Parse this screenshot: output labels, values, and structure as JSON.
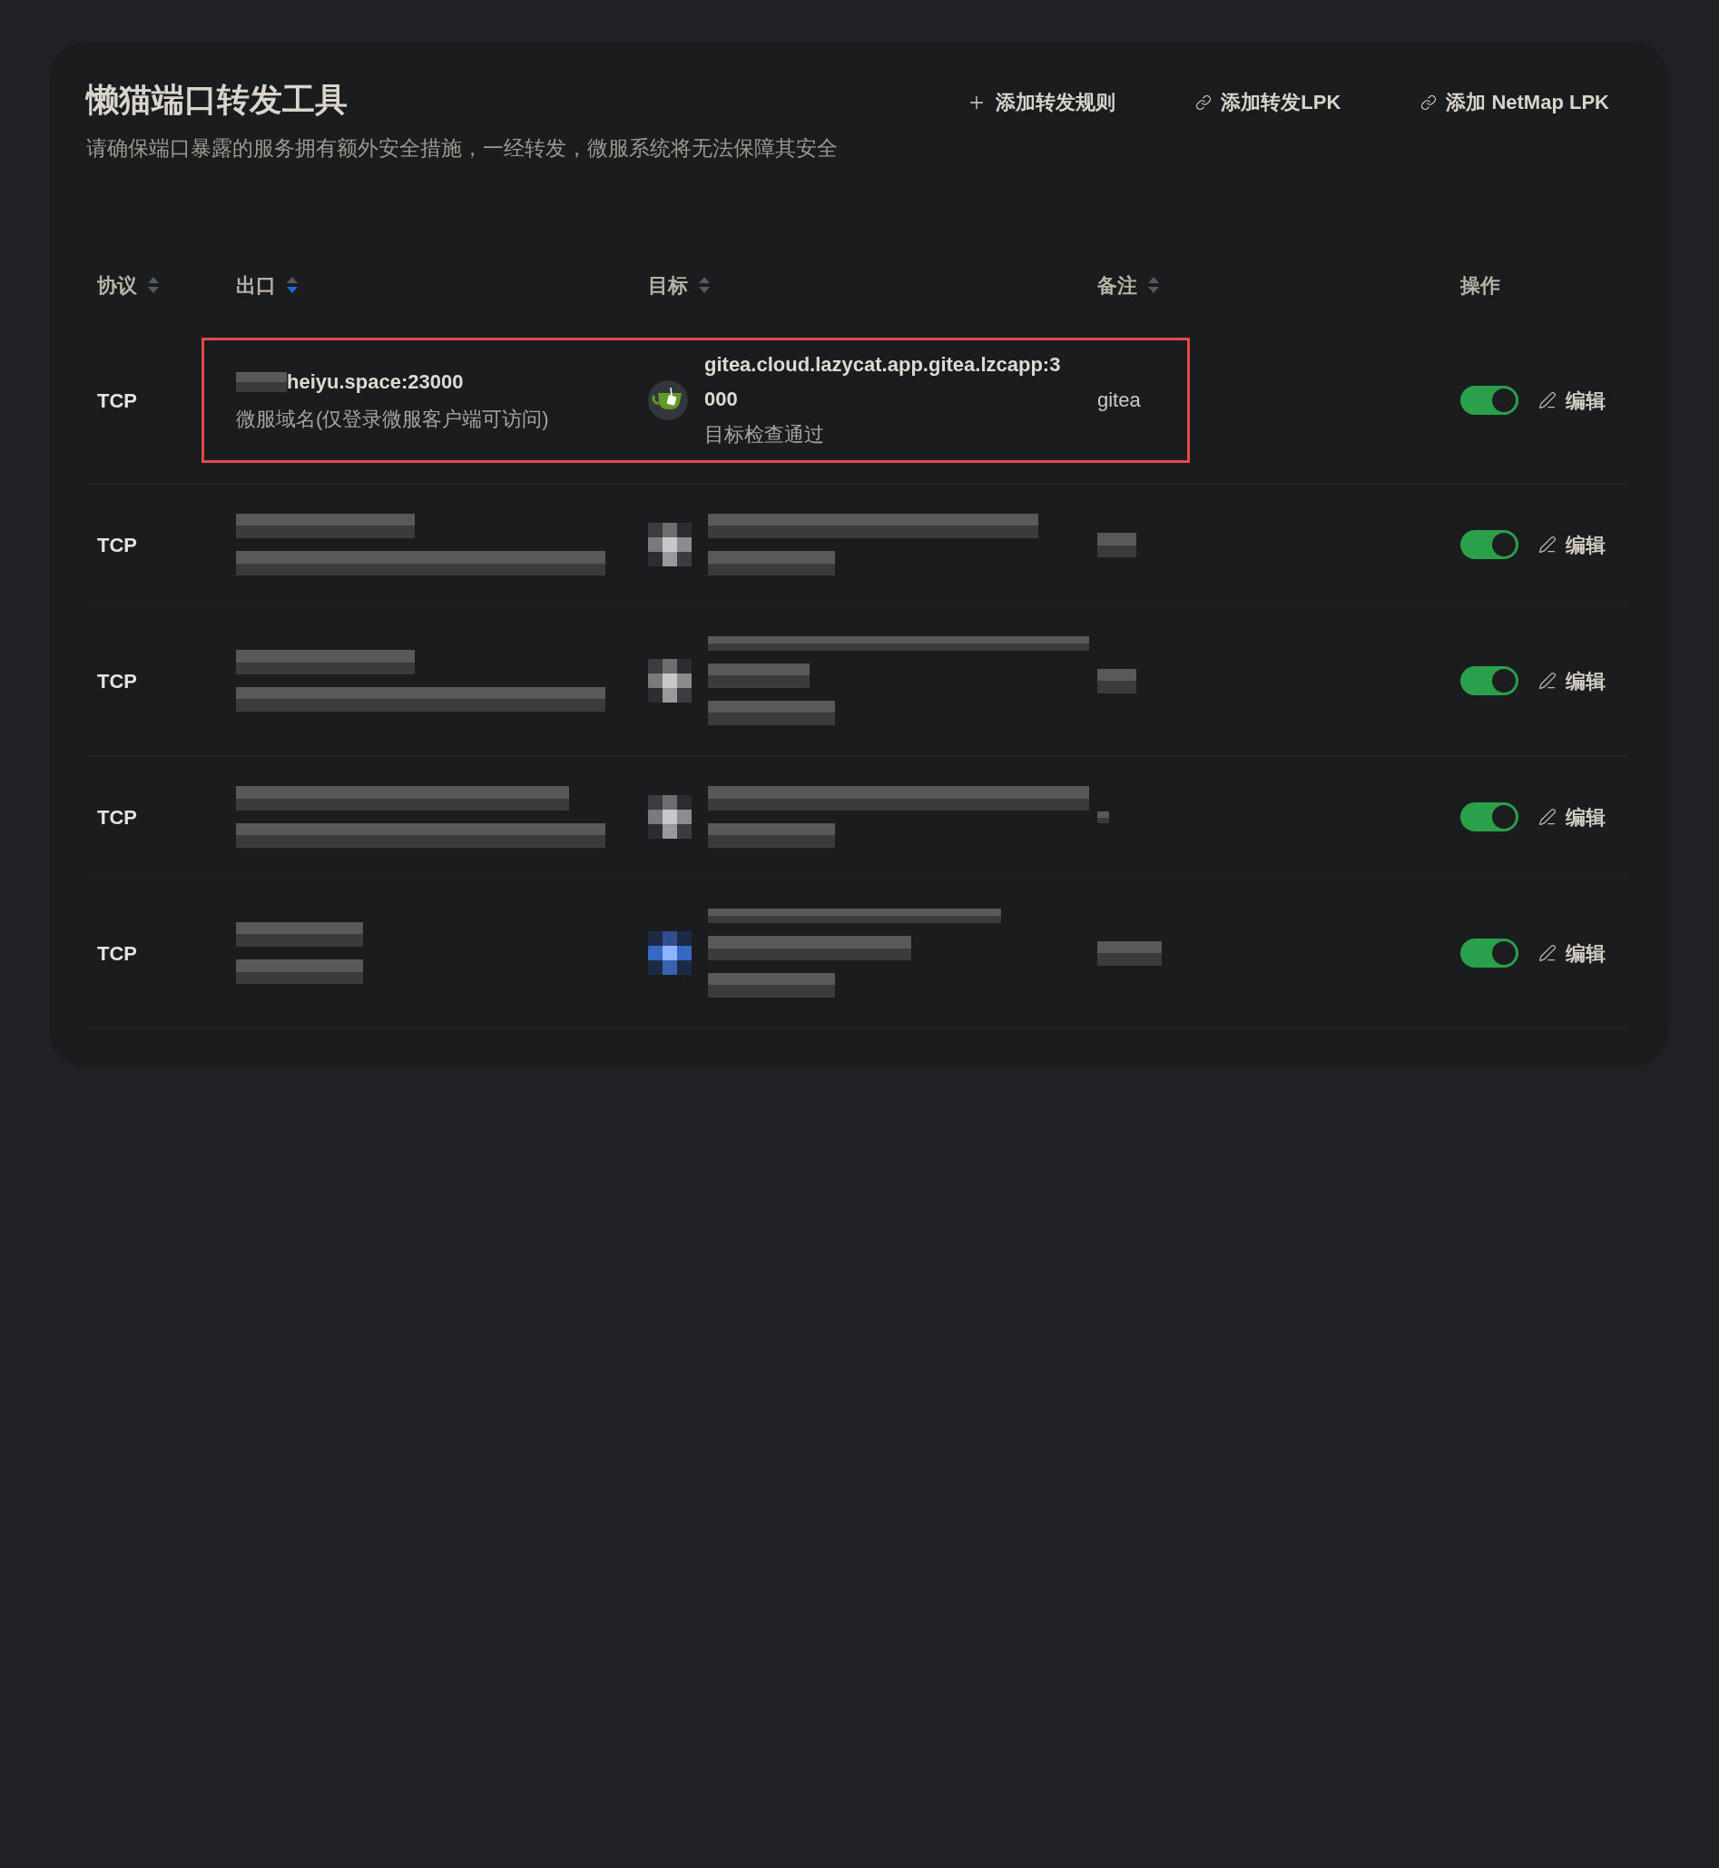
{
  "page": {
    "title": "懒猫端口转发工具",
    "subtitle": "请确保端口暴露的服务拥有额外安全措施，一经转发，微服系统将无法保障其安全"
  },
  "actions": [
    {
      "kind": "add",
      "label": "添加转发规则"
    },
    {
      "kind": "link",
      "label": "添加转发LPK"
    },
    {
      "kind": "link",
      "label": "添加 NetMap LPK"
    }
  ],
  "table": {
    "columns": [
      {
        "label": "协议",
        "sortable": true,
        "sorted_descending": false
      },
      {
        "label": "出口",
        "sortable": true,
        "sorted_descending": true
      },
      {
        "label": "目标",
        "sortable": true,
        "sorted_descending": false
      },
      {
        "label": "备注",
        "sortable": true,
        "sorted_descending": false
      },
      {
        "label": "操作",
        "sortable": false
      }
    ],
    "rows": [
      {
        "kind": "visible",
        "highlighted": true,
        "protocol": "TCP",
        "exit": {
          "masked_prefix": true,
          "address": "heiyu.space:23000",
          "scope": "微服域名(仅登录微服客户端可访问)"
        },
        "target": {
          "address": "gitea.cloud.lazycat.app.gitea.lzcapp:3000",
          "status": "目标检查通过"
        },
        "note": "gitea",
        "enabled": true,
        "edit_label": "编辑"
      },
      {
        "kind": "redacted",
        "highlighted": false,
        "protocol": "TCP",
        "enabled": true,
        "edit_label": "编辑"
      },
      {
        "kind": "redacted",
        "highlighted": false,
        "protocol": "TCP",
        "enabled": true,
        "edit_label": "编辑"
      },
      {
        "kind": "redacted",
        "highlighted": false,
        "protocol": "TCP",
        "enabled": true,
        "edit_label": "编辑"
      },
      {
        "kind": "redacted",
        "highlighted": false,
        "protocol": "TCP",
        "enabled": true,
        "edit_label": "编辑"
      }
    ]
  }
}
